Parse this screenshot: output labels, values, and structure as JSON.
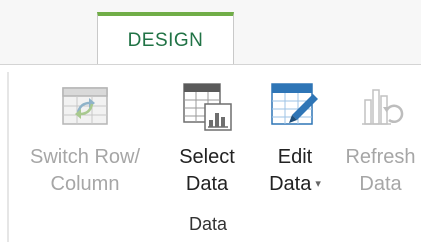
{
  "tabs": {
    "active_label": "DESIGN"
  },
  "group": {
    "label": "Data"
  },
  "commands": {
    "switch_row_column": {
      "line1": "Switch Row/",
      "line2": "Column",
      "icon": "switch-row-column-icon",
      "enabled": false
    },
    "select_data": {
      "line1": "Select",
      "line2": "Data",
      "icon": "select-data-icon",
      "enabled": true
    },
    "edit_data": {
      "line1": "Edit",
      "line2": "Data",
      "icon": "edit-data-icon",
      "enabled": true,
      "has_dropdown": true
    },
    "refresh_data": {
      "line1": "Refresh",
      "line2": "Data",
      "icon": "refresh-data-icon",
      "enabled": false
    }
  },
  "colors": {
    "accent": "#70ad47",
    "tab_text": "#217346",
    "disabled_text": "#a6a6a6"
  }
}
